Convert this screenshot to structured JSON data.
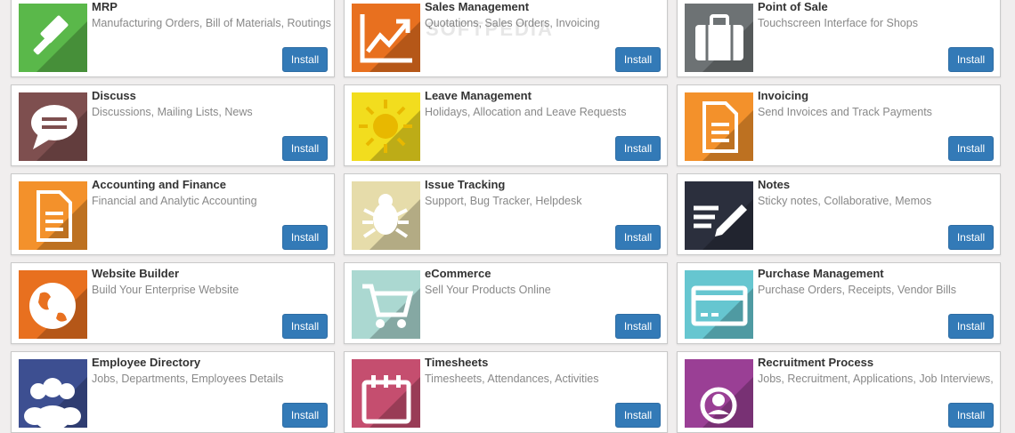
{
  "apps": [
    {
      "name": "MRP",
      "summary": "Manufacturing Orders, Bill of Materials, Routings",
      "button": "Install",
      "icon": "gavel-icon",
      "color": "#5ab84a"
    },
    {
      "name": "Sales Management",
      "summary": "Quotations, Sales Orders, Invoicing",
      "button": "Install",
      "icon": "trend-chart-icon",
      "color": "#e8701f"
    },
    {
      "name": "Point of Sale",
      "summary": "Touchscreen Interface for Shops",
      "button": "Install",
      "icon": "briefcase-icon",
      "color": "#6d7274"
    },
    {
      "name": "Discuss",
      "summary": "Discussions, Mailing Lists, News",
      "button": "Install",
      "icon": "chat-bubble-icon",
      "color": "#7e4f4f"
    },
    {
      "name": "Leave Management",
      "summary": "Holidays, Allocation and Leave Requests",
      "button": "Install",
      "icon": "sun-icon",
      "color": "#f2dd1e"
    },
    {
      "name": "Invoicing",
      "summary": "Send Invoices and Track Payments",
      "button": "Install",
      "icon": "document-icon",
      "color": "#f3912b"
    },
    {
      "name": "Accounting and Finance",
      "summary": "Financial and Analytic Accounting",
      "button": "Install",
      "icon": "document-icon",
      "color": "#f3912b"
    },
    {
      "name": "Issue Tracking",
      "summary": "Support, Bug Tracker, Helpdesk",
      "button": "Install",
      "icon": "bug-icon",
      "color": "#e6dcaa"
    },
    {
      "name": "Notes",
      "summary": "Sticky notes, Collaborative, Memos",
      "button": "Install",
      "icon": "pencil-lines-icon",
      "color": "#2b2f3d"
    },
    {
      "name": "Website Builder",
      "summary": "Build Your Enterprise Website",
      "button": "Install",
      "icon": "globe-icon",
      "color": "#e8701f"
    },
    {
      "name": "eCommerce",
      "summary": "Sell Your Products Online",
      "button": "Install",
      "icon": "shopping-cart-icon",
      "color": "#abd8d1"
    },
    {
      "name": "Purchase Management",
      "summary": "Purchase Orders, Receipts, Vendor Bills",
      "button": "Install",
      "icon": "credit-card-icon",
      "color": "#66c6d0"
    },
    {
      "name": "Employee Directory",
      "summary": "Jobs, Departments, Employees Details",
      "button": "Install",
      "icon": "people-icon",
      "color": "#3d4f91"
    },
    {
      "name": "Timesheets",
      "summary": "Timesheets, Attendances, Activities",
      "button": "Install",
      "icon": "calendar-icon",
      "color": "#c54e6f"
    },
    {
      "name": "Recruitment Process",
      "summary": "Jobs, Recruitment, Applications, Job Interviews,",
      "button": "Install",
      "icon": "user-search-icon",
      "color": "#9a3f95"
    }
  ],
  "watermark": "SOFTPEDIA"
}
